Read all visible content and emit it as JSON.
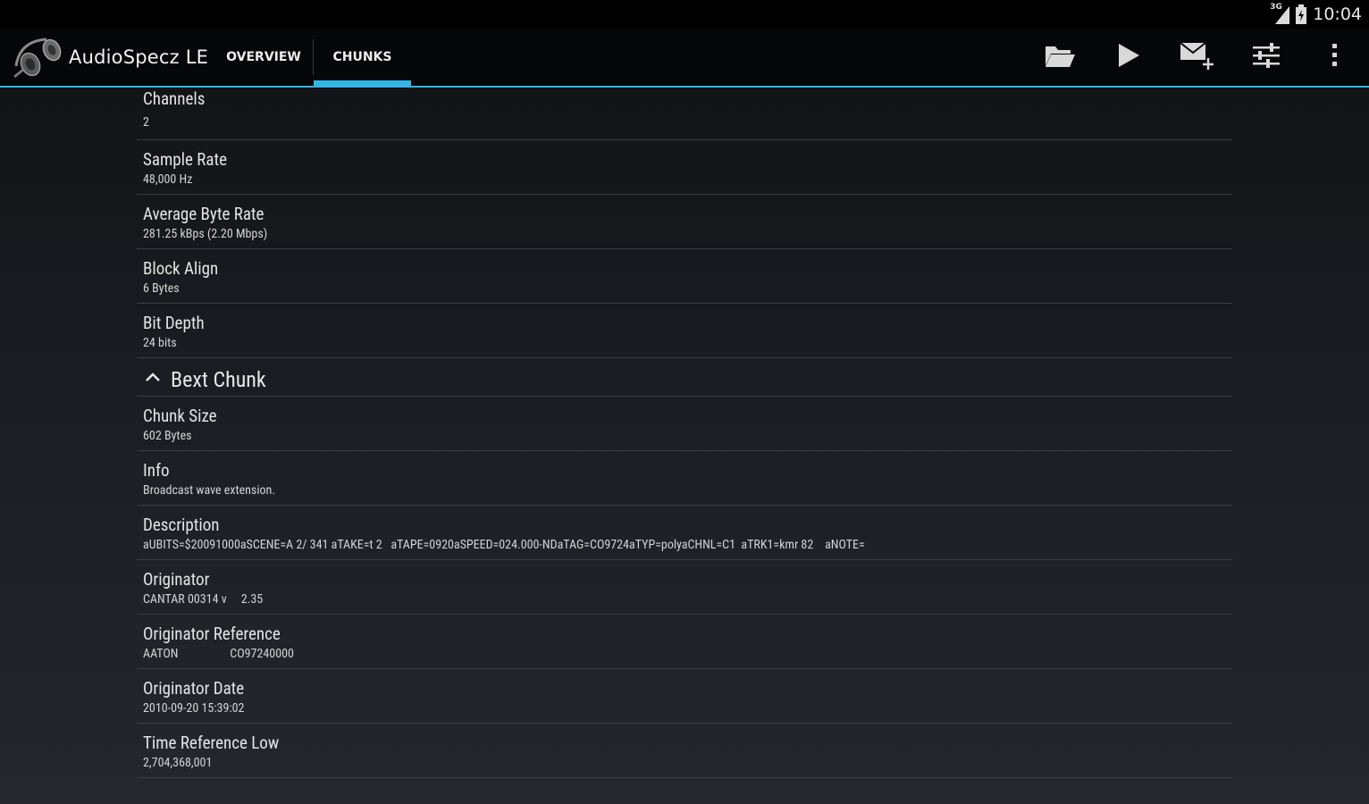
{
  "status_bar": {
    "network": "3G",
    "time": "10:04"
  },
  "action_bar": {
    "app_title": "AudioSpecz LE",
    "tabs": [
      {
        "label": "OVERVIEW",
        "selected": false
      },
      {
        "label": "CHUNKS",
        "selected": true
      }
    ],
    "actions": [
      "open-folder-icon",
      "play-icon",
      "email-add-icon",
      "equalizer-settings-icon",
      "overflow-menu-icon"
    ],
    "accent_color": "#33b5e5"
  },
  "format_rows": [
    {
      "title": "Channels",
      "value": "2"
    },
    {
      "title": "Sample Rate",
      "value": "48,000 Hz"
    },
    {
      "title": "Average Byte Rate",
      "value": "281.25 kBps (2.20 Mbps)"
    },
    {
      "title": "Block Align",
      "value": "6 Bytes"
    },
    {
      "title": "Bit Depth",
      "value": "24 bits"
    }
  ],
  "bext_section": {
    "title": "Bext Chunk",
    "rows": [
      {
        "title": "Chunk Size",
        "value": "602 Bytes"
      },
      {
        "title": "Info",
        "value": "Broadcast wave extension."
      },
      {
        "title": "Description",
        "value": "aUBITS=$20091000aSCENE=A 2/ 341 aTAKE=t 2   aTAPE=0920aSPEED=024.000-NDaTAG=CO9724aTYP=polyaCHNL=C1  aTRK1=kmr 82    aNOTE="
      },
      {
        "title": "Originator",
        "value": "CANTAR 00314 v     2.35"
      },
      {
        "title": "Originator Reference",
        "value": "AATON                  CO97240000"
      },
      {
        "title": "Originator Date",
        "value": "2010-09-20 15:39:02"
      },
      {
        "title": "Time Reference Low",
        "value": "2,704,368,001"
      }
    ]
  }
}
